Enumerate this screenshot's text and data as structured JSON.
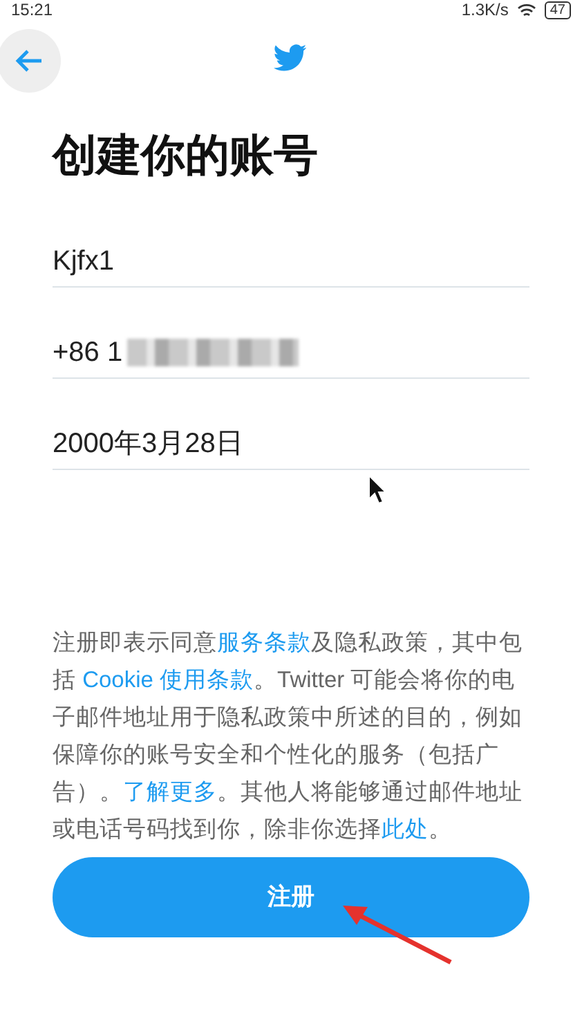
{
  "status_bar": {
    "time": "15:21",
    "speed": "1.3K/s",
    "battery": "47"
  },
  "title": "创建你的账号",
  "fields": [
    {
      "kind": "text",
      "value": "Kjfx1"
    },
    {
      "kind": "phone",
      "value": "+86 1",
      "redacted": true
    },
    {
      "kind": "text",
      "value": "2000年3月28日"
    }
  ],
  "notice": [
    {
      "text": "注册即表示同意",
      "link": false
    },
    {
      "text": "服务条款",
      "link": true
    },
    {
      "text": "及隐私政策，其中包括 ",
      "link": false
    },
    {
      "text": "Cookie 使用条款",
      "link": true
    },
    {
      "text": "。Twitter 可能会将你的电子邮件地址用于隐私政策中所述的目的，例如保障你的账号安全和个性化的服务（包括广告）。",
      "link": false
    },
    {
      "text": "了解更多",
      "link": true
    },
    {
      "text": "。其他人将能够通过邮件地址或电话号码找到你，除非你选择",
      "link": false
    },
    {
      "text": "此处",
      "link": true
    },
    {
      "text": "。",
      "link": false
    }
  ],
  "signup_button": "注册"
}
